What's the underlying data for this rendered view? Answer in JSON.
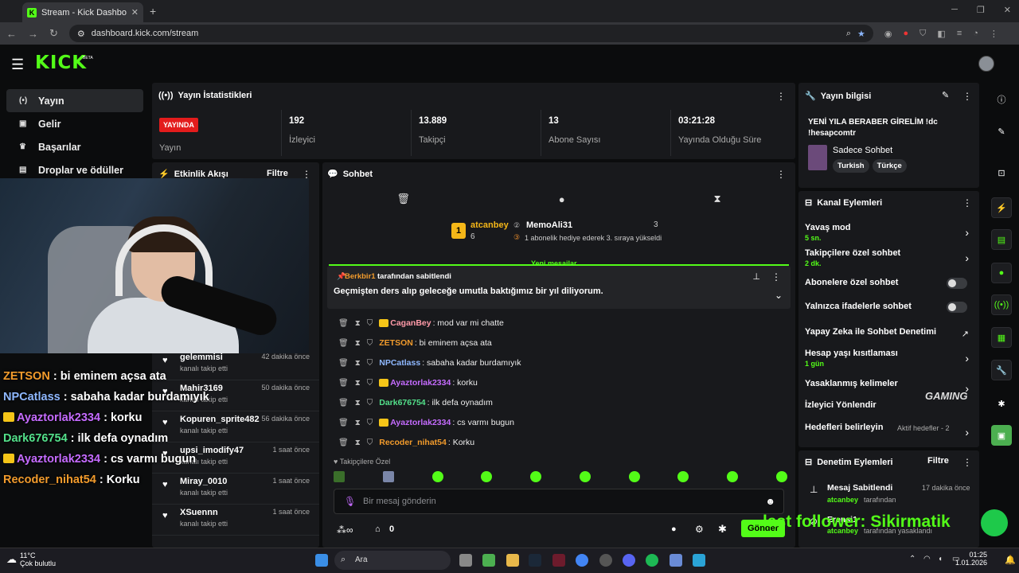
{
  "browser": {
    "tab_title": "Stream - Kick Dashboard",
    "url": "dashboard.kick.com/stream"
  },
  "app": {
    "logo": "KICK",
    "beta": "BETA"
  },
  "sidebar": {
    "items": [
      {
        "label": "Yayın",
        "icon": "broadcast-icon"
      },
      {
        "label": "Gelir",
        "icon": "wallet-icon"
      },
      {
        "label": "Başarılar",
        "icon": "trophy-icon"
      },
      {
        "label": "Droplar ve ödüller",
        "icon": "gift-icon"
      }
    ]
  },
  "stats": {
    "title": "Yayın İstatistikleri",
    "live_badge": "YAYINDA",
    "live_label": "Yayın",
    "viewers": "192",
    "viewers_label": "İzleyici",
    "followers": "13.889",
    "followers_label": "Takipçi",
    "subs": "13",
    "subs_label": "Abone Sayısı",
    "duration": "03:21:28",
    "duration_label": "Yayında Olduğu Süre"
  },
  "activity": {
    "title": "Etkinlik Akışı",
    "filter": "Filtre",
    "rows": [
      {
        "name": "gelemmisi",
        "sub": "kanalı takip etti",
        "time": "42 dakika önce"
      },
      {
        "name": "Mahir3169",
        "sub": "kanalı takip etti",
        "time": "50 dakika önce"
      },
      {
        "name": "Kopuren_sprite482",
        "sub": "kanalı takip etti",
        "time": "56 dakika önce"
      },
      {
        "name": "upsi_imodify47",
        "sub": "kanalı takip etti",
        "time": "1 saat önce"
      },
      {
        "name": "Miray_0010",
        "sub": "kanalı takip etti",
        "time": "1 saat önce"
      },
      {
        "name": "XSuennn",
        "sub": "kanalı takip etti",
        "time": "1 saat önce"
      }
    ]
  },
  "overlay": [
    {
      "user": "ZETSON",
      "text": " : bi eminem açsa ata",
      "color": "#f29b2c",
      "crown": false
    },
    {
      "user": "NPCatlass",
      "text": " : sabaha kadar burdamıyık",
      "color": "#8fb8ff",
      "crown": false
    },
    {
      "user": "Ayaztorlak2334",
      "text": " : korku",
      "color": "#c56bff",
      "crown": true
    },
    {
      "user": "Dark676754",
      "text": " : ilk defa oynadım",
      "color": "#53e08a",
      "crown": false
    },
    {
      "user": "Ayaztorlak2334",
      "text": " : cs varmı bugun",
      "color": "#c56bff",
      "crown": true
    },
    {
      "user": "Recoder_nihat54",
      "text": " : Korku",
      "color": "#f29b2c",
      "crown": false
    }
  ],
  "chat": {
    "title": "Sohbet",
    "gift_top_user": "atcanbey",
    "gift_top_count": "6",
    "gift_user": "MemoAli31",
    "gift_count": "3",
    "gift_text": "1 abonelik hediye ederek 3. sıraya yükseldi",
    "new_messages": "Yeni mesajlar",
    "pinned_by": "Berkbir1",
    "pinned_by_suffix": "tarafından sabitlendi",
    "pinned_text": "Geçmişten ders alıp geleceğe umutla baktığımız bir yıl diliyorum.",
    "messages": [
      {
        "user": "CaganBey",
        "text": ": mod var mi chatte",
        "color": "#ff9aa8",
        "crown": true
      },
      {
        "user": "ZETSON",
        "text": ": bi eminem açsa ata",
        "color": "#f29b2c",
        "crown": false
      },
      {
        "user": "NPCatlass",
        "text": ": sabaha kadar burdamıyık",
        "color": "#8fb8ff",
        "crown": false
      },
      {
        "user": "Ayaztorlak2334",
        "text": ": korku",
        "color": "#c56bff",
        "crown": true
      },
      {
        "user": "Dark676754",
        "text": ": ilk defa oynadım",
        "color": "#53e08a",
        "crown": false
      },
      {
        "user": "Ayaztorlak2334",
        "text": ": cs varmı bugun",
        "color": "#c56bff",
        "crown": true
      },
      {
        "user": "Recoder_nihat54",
        "text": ": Korku",
        "color": "#f29b2c",
        "crown": false
      }
    ],
    "followers_only": "Takipçilere Özel",
    "input_placeholder": "Bir mesaj gönderin",
    "points": "0",
    "send": "Gönder"
  },
  "info": {
    "title": "Yayın bilgisi",
    "stream_title": "YENİ YILA BERABER GİRELİM !dc !hesapcomtr",
    "category": "Sadece Sohbet",
    "tags": [
      "Turkish",
      "Türkçe"
    ]
  },
  "channel": {
    "title": "Kanal Eylemleri",
    "rows": [
      {
        "label": "Yavaş mod",
        "value": "5 sn.",
        "type": "chev"
      },
      {
        "label": "Takipçilere özel sohbet",
        "value": "2 dk.",
        "type": "chev"
      },
      {
        "label": "Abonelere özel sohbet",
        "value": "",
        "type": "toggle"
      },
      {
        "label": "Yalnızca ifadelerle sohbet",
        "value": "",
        "type": "toggle"
      },
      {
        "label": "Yapay Zeka ile Sohbet Denetimi",
        "value": "",
        "type": "ext"
      },
      {
        "label": "Hesap yaşı kısıtlaması",
        "value": "1 gün",
        "type": "chev"
      },
      {
        "label": "Yasaklanmış kelimeler",
        "value": "",
        "type": "chev"
      },
      {
        "label": "İzleyici Yönlendir",
        "value": "",
        "type": "none"
      },
      {
        "label": "Hedefleri belirleyin",
        "value": "Aktif hedefler - 2",
        "type": "chev"
      }
    ]
  },
  "mod": {
    "title": "Denetim Eylemleri",
    "filter": "Filtre",
    "rows": [
      {
        "label": "Mesaj Sabitlendi",
        "by": "atcanbey",
        "suffix": "tarafından",
        "time": "17 dakika önce"
      },
      {
        "label": "Erensi1",
        "by": "atcanbey",
        "suffix": "tarafından yasaklandı",
        "time": ""
      }
    ]
  },
  "stream_overlay": {
    "follower_text": "last follower: Sikirmatik",
    "gaming": "GAMING"
  },
  "taskbar": {
    "temp": "11°C",
    "weather": "Çok bulutlu",
    "search": "Ara",
    "time": "01:25",
    "date": "1.01.2026"
  }
}
